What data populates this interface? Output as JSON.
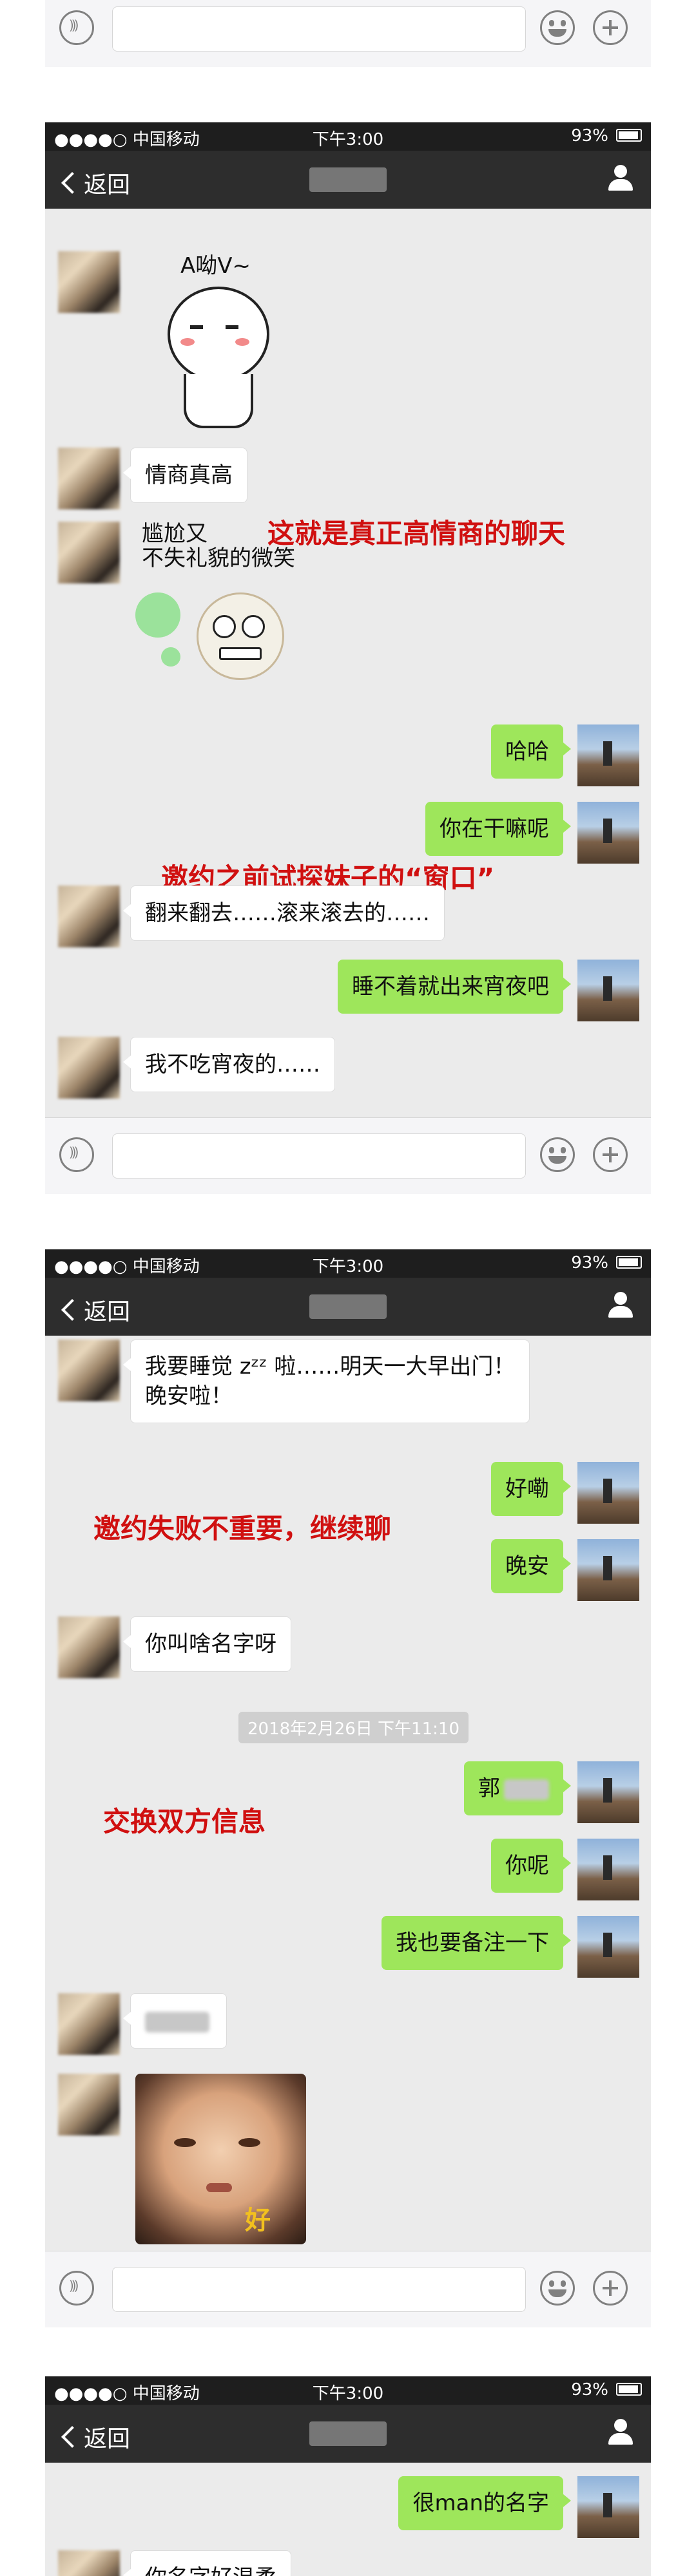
{
  "status": {
    "carrier": "●●●●○ 中国移动",
    "time": "下午3:00",
    "battery": "93%"
  },
  "nav": {
    "back": "返回"
  },
  "panel1": {
    "sticker1_text": "A呦V~",
    "msg_l1": "情商真高",
    "sticker2_text": "尴尬又\n不失礼貌的微笑",
    "anno1": "这就是真正高情商的聊天",
    "msg_r1": "哈哈",
    "msg_r2": "你在干嘛呢",
    "anno2": "邀约之前试探妹子的“窗口”",
    "msg_l2": "翻来翻去……滚来滚去的……",
    "msg_r3": "睡不着就出来宵夜吧",
    "msg_l3": "我不吃宵夜的……"
  },
  "panel2": {
    "msg_l1": "我要睡觉 zᶻᶻ 啦……明天一大早出门！\n晚安啦！",
    "msg_r1": "好嘞",
    "anno1": "邀约失败不重要，继续聊",
    "msg_r2": "晚安",
    "msg_l2": "你叫啥名字呀",
    "timestamp": "2018年2月26日 下午11:10",
    "msg_r3": "郭",
    "anno2": "交换双方信息",
    "msg_r4": "你呢",
    "msg_r5": "我也要备注一下",
    "sticker_text": "好"
  },
  "panel3": {
    "msg_r1": "很man的名字",
    "msg_l1": "你名字好温柔"
  }
}
